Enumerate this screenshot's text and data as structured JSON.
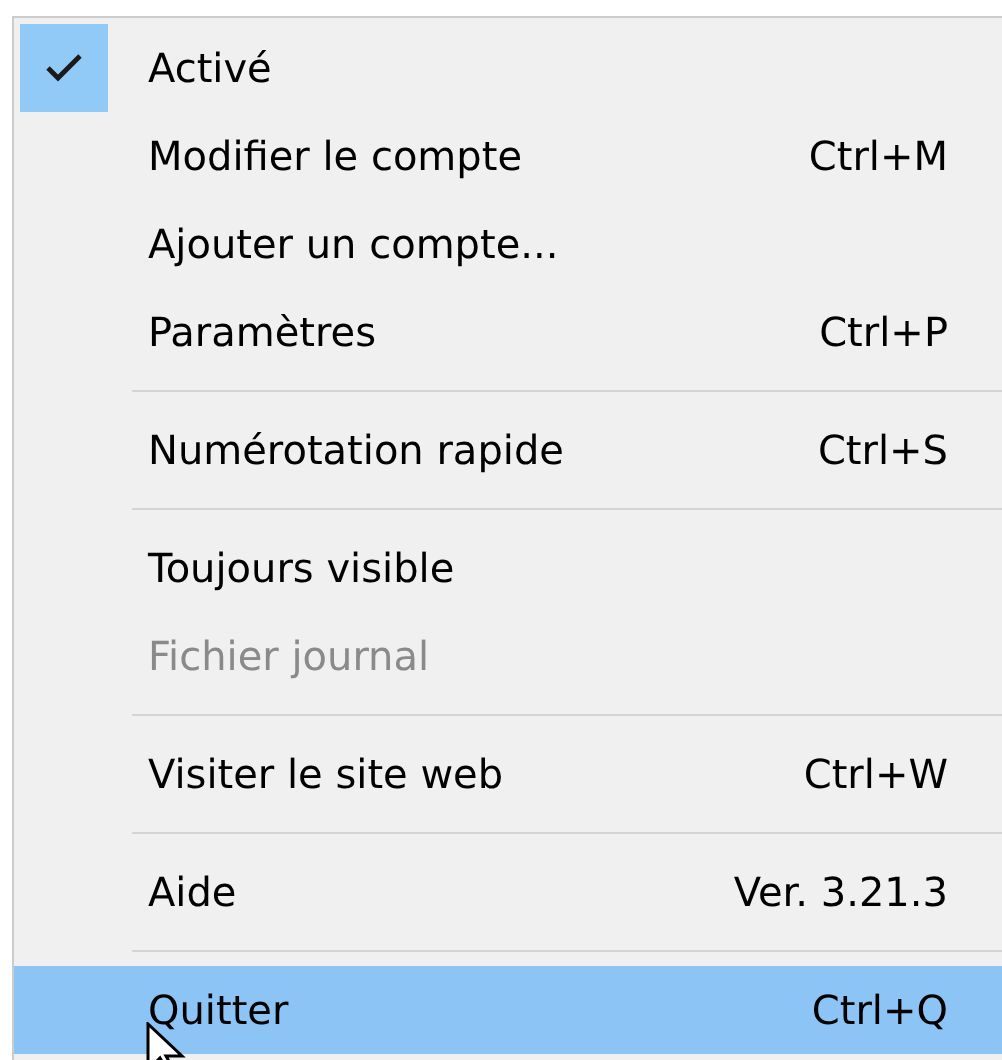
{
  "menu": {
    "items": [
      {
        "kind": "item",
        "label": "Activé",
        "checked": true,
        "disabled": false,
        "selected": false
      },
      {
        "kind": "item",
        "label": "Modifier le compte",
        "shortcut": "Ctrl+M",
        "checked": false,
        "disabled": false,
        "selected": false
      },
      {
        "kind": "item",
        "label": "Ajouter un compte...",
        "checked": false,
        "disabled": false,
        "selected": false
      },
      {
        "kind": "item",
        "label": "Paramètres",
        "shortcut": "Ctrl+P",
        "checked": false,
        "disabled": false,
        "selected": false
      },
      {
        "kind": "separator"
      },
      {
        "kind": "item",
        "label": "Numérotation rapide",
        "shortcut": "Ctrl+S",
        "checked": false,
        "disabled": false,
        "selected": false
      },
      {
        "kind": "separator"
      },
      {
        "kind": "item",
        "label": "Toujours visible",
        "checked": false,
        "disabled": false,
        "selected": false
      },
      {
        "kind": "item",
        "label": "Fichier journal",
        "checked": false,
        "disabled": true,
        "selected": false
      },
      {
        "kind": "separator"
      },
      {
        "kind": "item",
        "label": "Visiter le site web",
        "shortcut": "Ctrl+W",
        "checked": false,
        "disabled": false,
        "selected": false
      },
      {
        "kind": "separator"
      },
      {
        "kind": "item",
        "label": "Aide",
        "shortcut": "Ver. 3.21.3",
        "checked": false,
        "disabled": false,
        "selected": false
      },
      {
        "kind": "separator"
      },
      {
        "kind": "item",
        "label": "Quitter",
        "shortcut": "Ctrl+Q",
        "checked": false,
        "disabled": false,
        "selected": true
      }
    ]
  }
}
